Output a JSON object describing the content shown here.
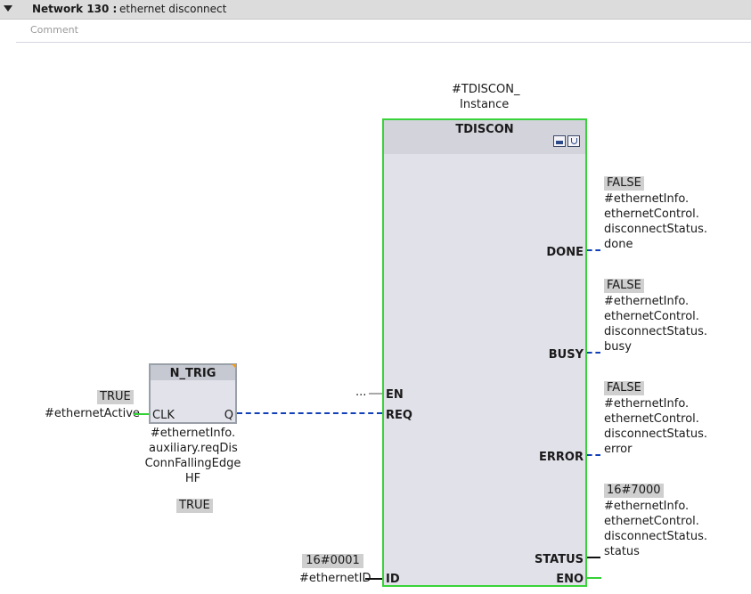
{
  "network": {
    "label": "Network 130 :",
    "title": "ethernet disconnect",
    "comment_placeholder": "Comment"
  },
  "instance": {
    "line1": "#TDISCON_",
    "line2": "Instance"
  },
  "block": {
    "name": "TDISCON",
    "inputs": {
      "en": "EN",
      "req": "REQ",
      "id": "ID"
    },
    "outputs": {
      "done": "DONE",
      "busy": "BUSY",
      "error": "ERROR",
      "status": "STATUS",
      "eno": "ENO"
    },
    "en_connection": "..."
  },
  "ntrig": {
    "name": "N_TRIG",
    "clk": "CLK",
    "q": "Q",
    "input_value": "TRUE",
    "input_var": "#ethernetActive",
    "var_lines": [
      "#ethernetInfo.",
      "auxiliary.reqDis",
      "ConnFallingEdge",
      "HF"
    ],
    "var_value": "TRUE"
  },
  "id_param": {
    "value": "16#0001",
    "var": "#ethernetID"
  },
  "done_out": {
    "value": "FALSE",
    "lines": [
      "#ethernetInfo.",
      "ethernetControl.",
      "disconnectStatus.",
      "done"
    ]
  },
  "busy_out": {
    "value": "FALSE",
    "lines": [
      "#ethernetInfo.",
      "ethernetControl.",
      "disconnectStatus.",
      "busy"
    ]
  },
  "error_out": {
    "value": "FALSE",
    "lines": [
      "#ethernetInfo.",
      "ethernetControl.",
      "disconnectStatus.",
      "error"
    ]
  },
  "status_out": {
    "value": "16#7000",
    "lines": [
      "#ethernetInfo.",
      "ethernetControl.",
      "disconnectStatus.",
      "status"
    ]
  },
  "colors": {
    "powerflow": "#35d235",
    "bool_wire": "#1240b8",
    "block_border": "#3ad23a",
    "edge_marker": "#f39c12"
  }
}
